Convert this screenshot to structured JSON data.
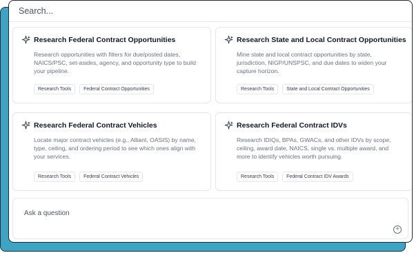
{
  "search": {
    "placeholder": "Search..."
  },
  "cards": [
    {
      "title": "Research Federal Contract Opportunities",
      "description": "Research opportunities with filters for due/posted dates, NAICS/PSC, set-asides, agency, and opportunity type to build your pipeline.",
      "tags": [
        "Research Tools",
        "Federal Contract Opportunities"
      ],
      "icon": "sparkle-icon"
    },
    {
      "title": "Research State and Local Contract Opportunities",
      "description": "Mine state and local contract opportunities by state, jurisdiction, NIGP/UNSPSC, and due dates to widen your capture horizon.",
      "tags": [
        "Research Tools",
        "State and Local Contract Opportunities"
      ],
      "icon": "sparkle-icon"
    },
    {
      "title": "Research Federal Contract Vehicles",
      "description": "Locate major contract vehicles (e.g., Alliant, OASIS) by name, type, ceiling, and ordering period to see which ones align with your services.",
      "tags": [
        "Research Tools",
        "Federal Contract Vehicles"
      ],
      "icon": "sparkle-icon"
    },
    {
      "title": "Research Federal Contract IDVs",
      "description": "Research IDIQs, BPAs, GWACs, and other IDVs by scope, ceiling, award date, NAICS, single vs. multiple award, and more to identify vehicles worth pursuing.",
      "tags": [
        "Research Tools",
        "Federal Contract IDV Awards"
      ],
      "icon": "sparkle-icon"
    }
  ],
  "ask": {
    "placeholder": "Ask a question",
    "add_icon": "plus-circle-icon"
  },
  "colors": {
    "backdrop": "#3fa3c4",
    "sparkle": "#1f2937"
  }
}
